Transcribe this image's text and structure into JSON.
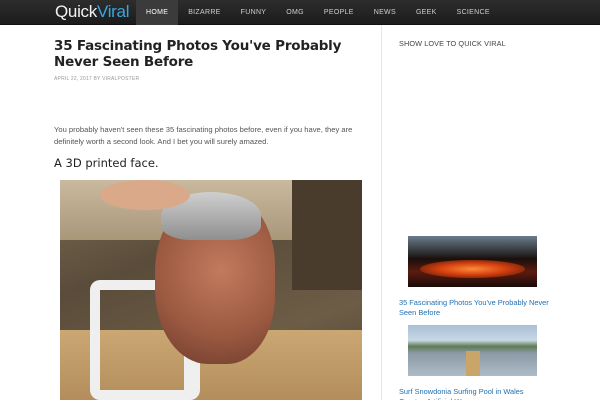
{
  "brand": {
    "logo_part1": "Quick",
    "logo_part2": "Viral",
    "accent": "#36a7e0"
  },
  "nav": {
    "items": [
      "HOME",
      "BIZARRE",
      "FUNNY",
      "OMG",
      "PEOPLE",
      "NEWS",
      "GEEK",
      "SCIENCE"
    ],
    "active": "HOME"
  },
  "article": {
    "title": "35 Fascinating Photos You've Probably Never Seen Before",
    "meta": "APRIL 22, 2017 BY VIRALPOSTER",
    "intro": "You probably haven't seen these 35 fascinating photos before, even if you have, they are definitely worth a second look. And I bet you will surely amazed.",
    "section_heading": "A 3D printed face."
  },
  "sidebar": {
    "title": "SHOW LOVE TO QUICK VIRAL",
    "posts": [
      {
        "title": "35 Fascinating Photos You've Probably Never Seen Before"
      },
      {
        "title": "Surf Snowdonia Surfing Pool in Wales Creates Artificial Waves"
      }
    ]
  }
}
